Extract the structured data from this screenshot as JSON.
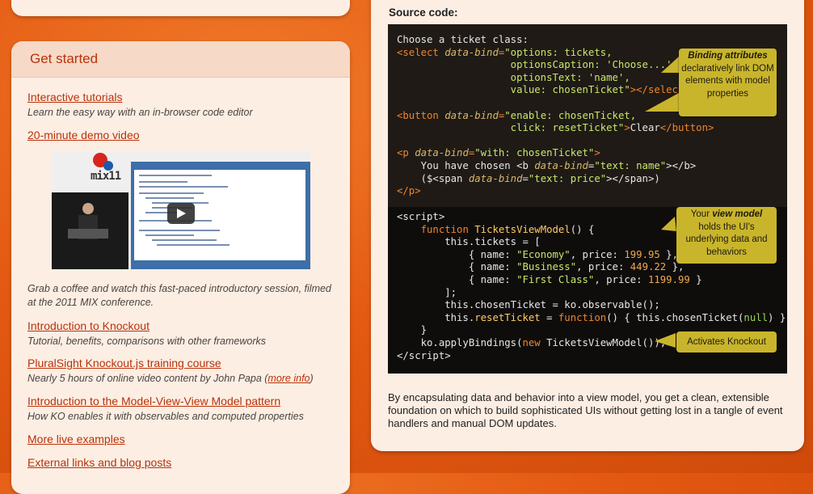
{
  "get_started": {
    "title": "Get started",
    "items": [
      {
        "link": "Interactive tutorials",
        "desc": "Learn the easy way with an in-browser code editor"
      },
      {
        "link": "20-minute demo video",
        "desc": ""
      },
      {
        "link": "Introduction to Knockout",
        "desc": "Tutorial, benefits, comparisons with other frameworks"
      },
      {
        "link": "PluralSight Knockout.js training course",
        "desc": "Nearly 5 hours of online video content by John Papa (",
        "desc_link": "more info",
        "desc_tail": ")"
      },
      {
        "link": "Introduction to the Model-View-View Model pattern",
        "desc": "How KO enables it with observables and computed properties"
      },
      {
        "link": "More live examples",
        "desc": ""
      },
      {
        "link": "External links and blog posts",
        "desc": ""
      }
    ],
    "video_caption": "Grab a coffee and watch this fast-paced introductory session, filmed at the 2011 MIX conference.",
    "video_logo": "mix11"
  },
  "source": {
    "title": "Source code:",
    "callouts": {
      "binding": {
        "strong": "Binding attributes",
        "rest": "declaratively link DOM elements with model properties"
      },
      "viewmodel": {
        "pre": "Your ",
        "strong": "view model",
        "rest": "holds the UI's underlying data and behaviors"
      },
      "activates": "Activates Knockout"
    },
    "summary": "By encapsulating data and behavior into a view model, you get a clean, extensible foundation on which to build sophisticated UIs without getting lost in a tangle of event handlers and manual DOM updates."
  },
  "colors": {
    "accent": "#b8320a",
    "background": "#e45a12",
    "panel": "#fdeee3",
    "callout": "#c9b52c"
  }
}
